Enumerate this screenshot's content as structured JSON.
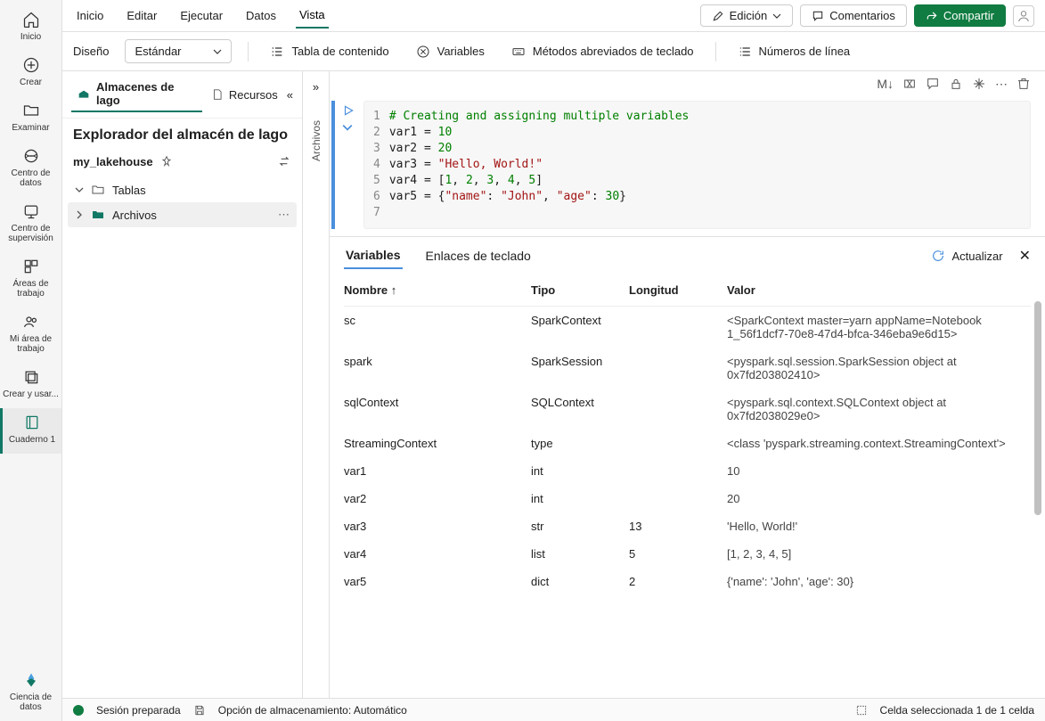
{
  "left_nav": [
    {
      "id": "inicio",
      "label": "Inicio"
    },
    {
      "id": "crear",
      "label": "Crear"
    },
    {
      "id": "examinar",
      "label": "Examinar"
    },
    {
      "id": "centro-datos",
      "label": "Centro de datos"
    },
    {
      "id": "centro-supervision",
      "label": "Centro de supervisión"
    },
    {
      "id": "areas-trabajo",
      "label": "Áreas de trabajo"
    },
    {
      "id": "mi-area",
      "label": "Mi área de trabajo"
    },
    {
      "id": "crear-usar",
      "label": "Crear y usar..."
    },
    {
      "id": "cuaderno",
      "label": "Cuaderno 1"
    }
  ],
  "bottom_nav": {
    "label": "Ciencia de datos"
  },
  "menubar": [
    "Inicio",
    "Editar",
    "Ejecutar",
    "Datos",
    "Vista"
  ],
  "menubar_active": 4,
  "menu_right": {
    "edicion": "Edición",
    "comentarios": "Comentarios",
    "compartir": "Compartir"
  },
  "toolbar": {
    "diseno": "Diseño",
    "estandar": "Estándar",
    "tabla": "Tabla de contenido",
    "variables": "Variables",
    "metodos": "Métodos abreviados de teclado",
    "numeros": "Números de línea"
  },
  "explorer": {
    "tab_almacenes": "Almacenes de lago",
    "tab_recursos": "Recursos",
    "title": "Explorador del almacén de lago",
    "lakehouse": "my_lakehouse",
    "tree": {
      "tablas": "Tablas",
      "archivos": "Archivos"
    }
  },
  "vertical_tab": "Archivos",
  "code": {
    "lines": [
      "1",
      "2",
      "3",
      "4",
      "5",
      "6",
      "7"
    ]
  },
  "cell_toolbar": {
    "markdown": "M↓"
  },
  "panel": {
    "tab_variables": "Variables",
    "tab_enlaces": "Enlaces de teclado",
    "actualizar": "Actualizar",
    "columns": {
      "nombre": "Nombre",
      "tipo": "Tipo",
      "longitud": "Longitud",
      "valor": "Valor"
    },
    "sort": "↑"
  },
  "variables": [
    {
      "name": "sc",
      "type": "SparkContext",
      "len": "",
      "val": "<SparkContext master=yarn appName=Notebook 1_56f1dcf7-70e8-47d4-bfca-346eba9e6d15>"
    },
    {
      "name": "spark",
      "type": "SparkSession",
      "len": "",
      "val": "<pyspark.sql.session.SparkSession object at 0x7fd203802410>"
    },
    {
      "name": "sqlContext",
      "type": "SQLContext",
      "len": "",
      "val": "<pyspark.sql.context.SQLContext object at 0x7fd2038029e0>"
    },
    {
      "name": "StreamingContext",
      "type": "type",
      "len": "",
      "val": "<class 'pyspark.streaming.context.StreamingContext'>"
    },
    {
      "name": "var1",
      "type": "int",
      "len": "",
      "val": "10"
    },
    {
      "name": "var2",
      "type": "int",
      "len": "",
      "val": "20"
    },
    {
      "name": "var3",
      "type": "str",
      "len": "13",
      "val": "'Hello, World!'"
    },
    {
      "name": "var4",
      "type": "list",
      "len": "5",
      "val": "[1, 2, 3, 4, 5]"
    },
    {
      "name": "var5",
      "type": "dict",
      "len": "2",
      "val": "{'name': 'John', 'age': 30}"
    }
  ],
  "statusbar": {
    "session": "Sesión preparada",
    "storage": "Opción de almacenamiento: Automático",
    "cell": "Celda seleccionada 1 de 1 celda"
  }
}
